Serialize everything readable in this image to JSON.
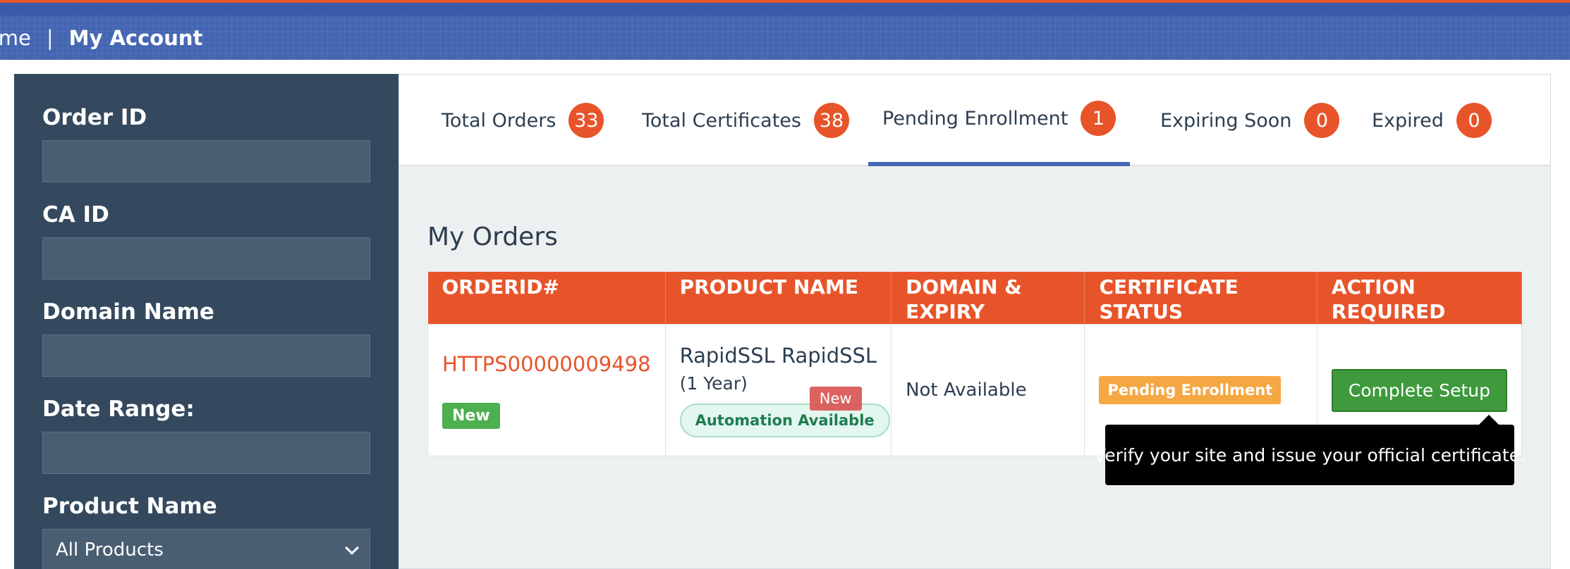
{
  "breadcrumb": {
    "home": "ome",
    "separator": "|",
    "current": "My Account"
  },
  "sidebar": {
    "order_id_label": "Order ID",
    "ca_id_label": "CA ID",
    "domain_name_label": "Domain Name",
    "date_range_label": "Date Range:",
    "product_name_label": "Product Name",
    "product_name_value": "All Products"
  },
  "tabs": [
    {
      "label": "Total Orders",
      "count": "33"
    },
    {
      "label": "Total Certificates",
      "count": "38"
    },
    {
      "label": "Pending Enrollment",
      "count": "1",
      "active": true
    },
    {
      "label": "Expiring Soon",
      "count": "0"
    },
    {
      "label": "Expired",
      "count": "0"
    }
  ],
  "orders": {
    "title": "My Orders",
    "columns": [
      "ORDERID#",
      "PRODUCT NAME",
      "DOMAIN & EXPIRY",
      "CERTIFICATE STATUS",
      "ACTION REQUIRED"
    ],
    "rows": [
      {
        "order_id": "HTTPS00000009498",
        "order_badge": "New",
        "product": "RapidSSL RapidSSL",
        "term": "(1 Year)",
        "product_badge": "New",
        "automation": "Automation Available",
        "domain_expiry": "Not Available",
        "status": "Pending Enrollment",
        "action": "Complete Setup"
      }
    ]
  },
  "tooltip": "Verify your site and issue your official certificate.",
  "colors": {
    "accent": "#e8542a",
    "brand": "#4466b2",
    "sidebar": "#34495e"
  }
}
